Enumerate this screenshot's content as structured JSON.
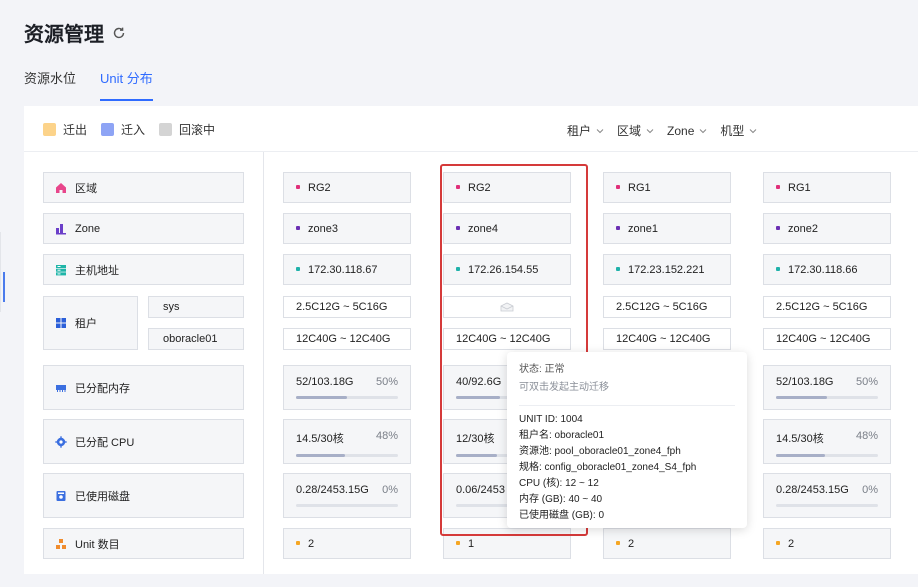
{
  "page": {
    "title": "资源管理",
    "refresh_icon": "refresh-icon"
  },
  "tabs": [
    {
      "label": "资源水位",
      "active": false
    },
    {
      "label": "Unit 分布",
      "active": true
    }
  ],
  "legend": [
    {
      "label": "迁出",
      "color": "#fcd38a"
    },
    {
      "label": "迁入",
      "color": "#8ea4f5"
    },
    {
      "label": "回滚中",
      "color": "#d4d4d4"
    }
  ],
  "filters": [
    "租户",
    "区域",
    "Zone",
    "机型"
  ],
  "rows": {
    "region": {
      "label": "区域",
      "icon": "home-icon"
    },
    "zone": {
      "label": "Zone",
      "icon": "bar-chart-icon"
    },
    "host": {
      "label": "主机地址",
      "icon": "server-icon"
    },
    "tenant": {
      "label": "租户",
      "icon": "grid-icon",
      "sub": [
        "sys",
        "oboracle01"
      ]
    },
    "memory": {
      "label": "已分配内存",
      "icon": "memory-icon"
    },
    "cpu": {
      "label": "已分配 CPU",
      "icon": "cpu-icon"
    },
    "disk": {
      "label": "已使用磁盘",
      "icon": "disk-icon"
    },
    "units": {
      "label": "Unit 数目",
      "icon": "units-icon"
    }
  },
  "colors": {
    "region_dot": "#e0307a",
    "zone_dot": "#6b2fb3",
    "host_dot": "#20b2aa",
    "unit_dot": "#f5a623",
    "accent": "#2f6bff",
    "highlight": "#d53a3a"
  },
  "columns": [
    {
      "region": "RG2",
      "zone": "zone3",
      "host": "172.30.118.67",
      "sys": "2.5C12G ~ 5C16G",
      "tenant2": "12C40G ~ 12C40G",
      "memory": "52/103.18G",
      "memory_pct": "50%",
      "memory_level": 0.5,
      "cpu": "14.5/30核",
      "cpu_pct": "48%",
      "cpu_level": 0.48,
      "disk": "0.28/2453.15G",
      "disk_pct": "0%",
      "disk_level": 0.0,
      "units": "2"
    },
    {
      "region": "RG2",
      "zone": "zone4",
      "host": "172.26.154.55",
      "sys": "",
      "tenant2": "12C40G ~ 12C40G",
      "memory": "40/92.6G",
      "memory_pct": "",
      "memory_level": 0.43,
      "cpu": "12/30核",
      "cpu_pct": "",
      "cpu_level": 0.4,
      "disk": "0.06/2453",
      "disk_pct": "",
      "disk_level": 0.0,
      "units": "1"
    },
    {
      "region": "RG1",
      "zone": "zone1",
      "host": "172.23.152.221",
      "sys": "2.5C12G ~ 5C16G",
      "tenant2": "12C40G ~ 12C40G",
      "memory": "",
      "memory_pct": "",
      "memory_level": 0.0,
      "cpu": "",
      "cpu_pct": "",
      "cpu_level": 0.0,
      "disk": "",
      "disk_pct": "",
      "disk_level": 0.0,
      "units": "2"
    },
    {
      "region": "RG1",
      "zone": "zone2",
      "host": "172.30.118.66",
      "sys": "2.5C12G ~ 5C16G",
      "tenant2": "12C40G ~ 12C40G",
      "memory": "52/103.18G",
      "memory_pct": "50%",
      "memory_level": 0.5,
      "cpu": "14.5/30核",
      "cpu_pct": "48%",
      "cpu_level": 0.48,
      "disk": "0.28/2453.15G",
      "disk_pct": "0%",
      "disk_level": 0.0,
      "units": "2"
    }
  ],
  "tooltip": {
    "status": "状态: 正常",
    "hint": "可双击发起主动迁移",
    "lines": [
      "UNIT ID: 1004",
      "租户名: oboracle01",
      "资源池: pool_oboracle01_zone4_fph",
      "规格: config_oboracle01_zone4_S4_fph",
      "CPU (核): 12 ~ 12",
      "内存 (GB): 40 ~ 40",
      "已使用磁盘 (GB): 0"
    ]
  }
}
